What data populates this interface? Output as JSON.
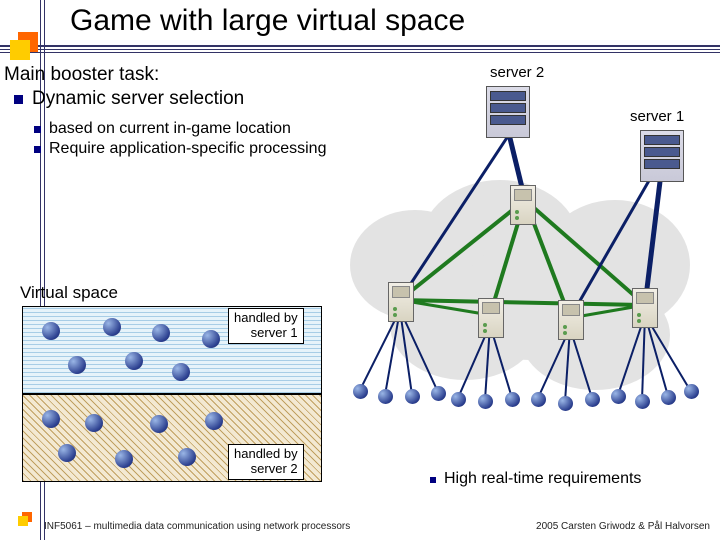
{
  "title": "Game with large virtual space",
  "main_task_intro": "Main booster task:",
  "main_task_bullet": "Dynamic server selection",
  "sub_bullets": [
    "based on current in-game location",
    "Require application-specific processing"
  ],
  "server_labels": {
    "s1": "server 1",
    "s2": "server 2"
  },
  "virtual_space_label": "Virtual space",
  "handled_by": {
    "s1": "handled by server 1",
    "s2": "handled by server 2"
  },
  "realtime_req": "High real-time requirements",
  "footer": {
    "left": "INF5061 – multimedia data communication using network processors",
    "right": "2005 Carsten Griwodz & Pål Halvorsen"
  }
}
